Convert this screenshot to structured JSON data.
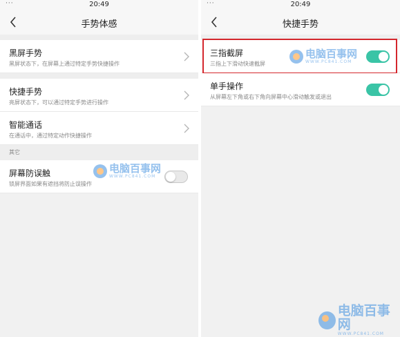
{
  "left": {
    "status": {
      "dots": "···",
      "time": "20:49"
    },
    "title": "手势体感",
    "items": [
      {
        "title": "黑屏手势",
        "subtitle": "黑屏状态下，在屏幕上通过特定手势快捷操作"
      },
      {
        "title": "快捷手势",
        "subtitle": "亮屏状态下，可以通过特定手势进行操作"
      },
      {
        "title": "智能通话",
        "subtitle": "在通话中，通过特定动作快捷操作"
      }
    ],
    "section_label": "其它",
    "toggle_item": {
      "title": "屏幕防误触",
      "subtitle": "锁屏界面如果有遮挡将防止误操作",
      "state": "off"
    }
  },
  "right": {
    "status": {
      "dots": "···",
      "time": "20:49"
    },
    "title": "快捷手势",
    "items": [
      {
        "title": "三指截屏",
        "subtitle": "三指上下滑动快速截屏",
        "state": "on"
      },
      {
        "title": "单手操作",
        "subtitle": "从屏幕左下角或右下角向屏幕中心滑动触发或退出",
        "state": "on"
      }
    ]
  },
  "watermark": {
    "text": "电脑百事网",
    "url": "WWW.PC841.COM"
  },
  "colors": {
    "toggle_on": "#3ac4a6",
    "highlight": "#d4262c",
    "watermark": "#3f8fe0"
  }
}
